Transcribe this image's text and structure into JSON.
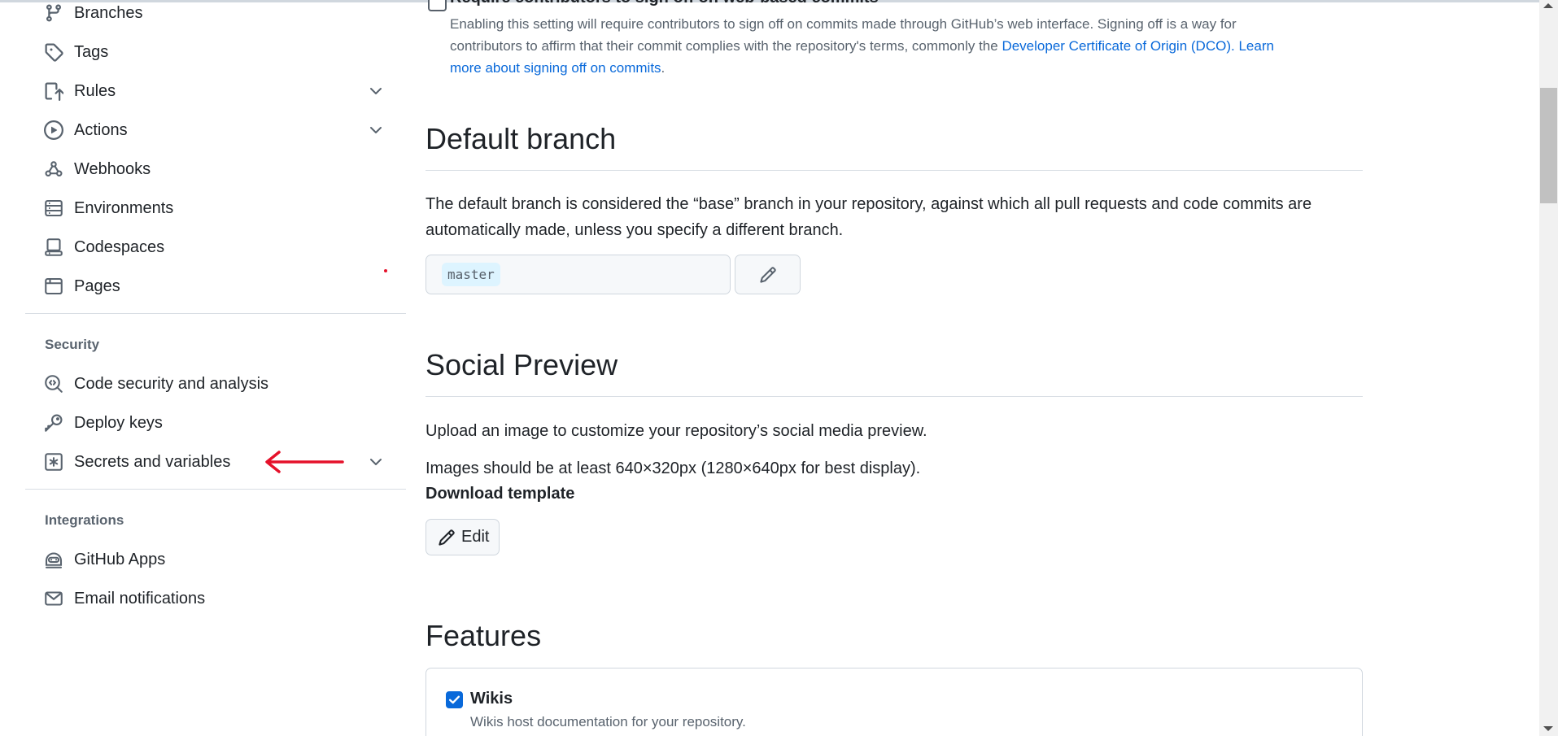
{
  "sidebar": {
    "items": [
      {
        "label": "Branches",
        "icon": "branch-icon"
      },
      {
        "label": "Tags",
        "icon": "tag-icon"
      },
      {
        "label": "Rules",
        "icon": "rules-icon"
      },
      {
        "label": "Actions",
        "icon": "play-icon"
      },
      {
        "label": "Webhooks",
        "icon": "webhook-icon"
      },
      {
        "label": "Environments",
        "icon": "server-icon"
      },
      {
        "label": "Codespaces",
        "icon": "codespaces-icon"
      },
      {
        "label": "Pages",
        "icon": "browser-icon"
      }
    ],
    "security": {
      "heading": "Security",
      "items": [
        {
          "label": "Code security and analysis",
          "icon": "codescan-icon"
        },
        {
          "label": "Deploy keys",
          "icon": "key-icon"
        },
        {
          "label": "Secrets and variables",
          "icon": "asterisk-icon"
        }
      ]
    },
    "integrations": {
      "heading": "Integrations",
      "items": [
        {
          "label": "GitHub Apps",
          "icon": "hubot-icon"
        },
        {
          "label": "Email notifications",
          "icon": "mail-icon"
        }
      ]
    }
  },
  "main": {
    "signoff": {
      "title": "Require contributors to sign off on web-based commits",
      "desc_line1": "Enabling this setting will require contributors to sign off on commits made through GitHub’s web interface. Signing off is a way for",
      "desc_line2_prefix": "contributors to affirm that their commit complies with the repository's terms, commonly the ",
      "dco_link": "Developer Certificate of Origin (DCO).",
      "learn_link_a": "Learn",
      "learn_link_b": "more about signing off on commits",
      "period": "."
    },
    "default_branch": {
      "heading": "Default branch",
      "desc_line1": "The default branch is considered the “base” branch in your repository, against which all pull requests and code commits are",
      "desc_line2": "automatically made, unless you specify a different branch.",
      "branch_name": "master"
    },
    "social_preview": {
      "heading": "Social Preview",
      "desc": "Upload an image to customize your repository’s social media preview.",
      "size_note": "Images should be at least 640×320px (1280×640px for best display).",
      "download_link": "Download template",
      "edit_label": "Edit"
    },
    "features": {
      "heading": "Features",
      "wikis_label": "Wikis",
      "wikis_checked": true,
      "wikis_desc": "Wikis host documentation for your repository."
    }
  },
  "colors": {
    "link": "#0969da",
    "annotation": "#e5112a"
  }
}
